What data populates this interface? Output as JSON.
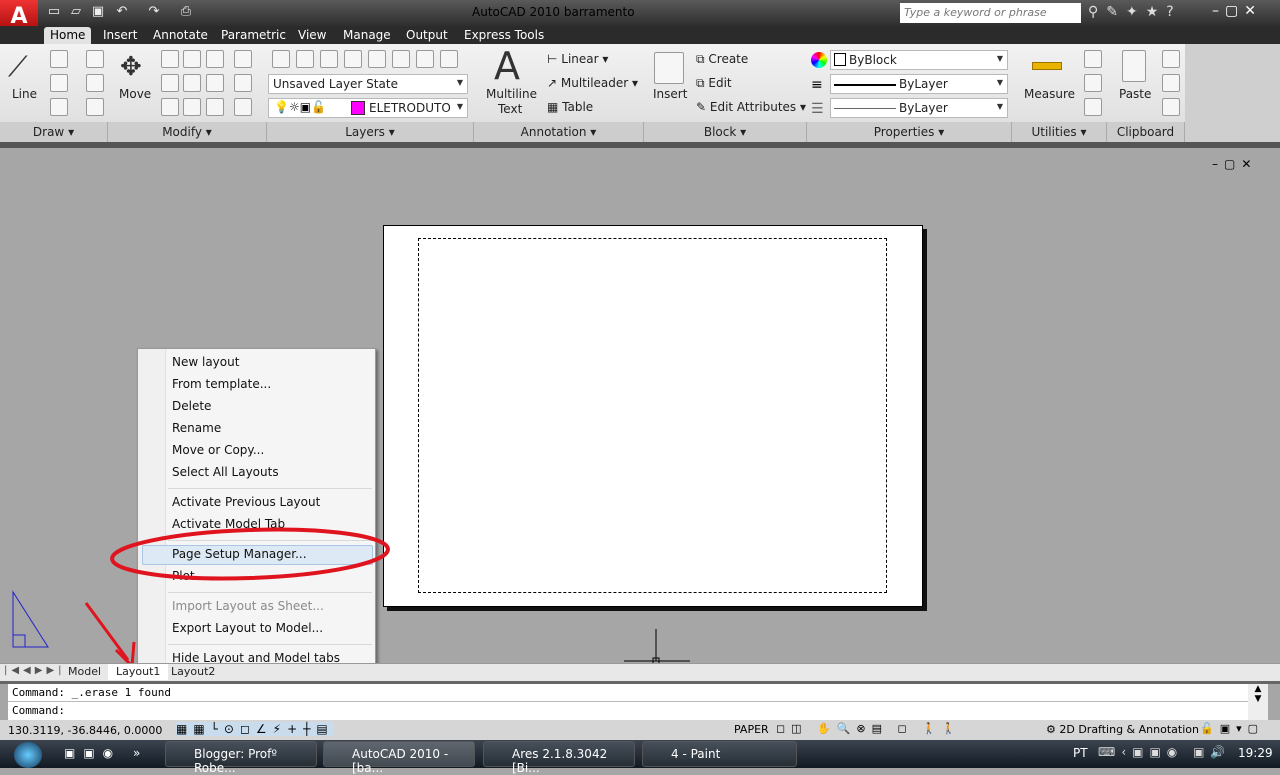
{
  "app": {
    "title": "AutoCAD 2010    barramento",
    "search_placeholder": "Type a keyword or phrase",
    "logo": "A"
  },
  "tabs": [
    "Home",
    "Insert",
    "Annotate",
    "Parametric",
    "View",
    "Manage",
    "Output",
    "Express Tools"
  ],
  "ribbon": {
    "draw": {
      "line": "Line",
      "panel": "Draw ▾"
    },
    "modify": {
      "move": "Move",
      "panel": "Modify ▾"
    },
    "layers": {
      "state": "Unsaved Layer State",
      "layer": "ELETRODUTO",
      "layer_color": "#ff00ff",
      "panel": "Layers ▾"
    },
    "annotation": {
      "mtext1": "Multiline",
      "mtext2": "Text",
      "linear": "Linear",
      "multileader": "Multileader",
      "table": "Table",
      "panel": "Annotation ▾"
    },
    "block": {
      "insert": "Insert",
      "create": "Create",
      "edit": "Edit",
      "edit_attributes": "Edit Attributes",
      "panel": "Block ▾"
    },
    "properties": {
      "color": "ByBlock",
      "lineweight": "ByLayer",
      "linetype": "ByLayer",
      "panel": "Properties ▾"
    },
    "utilities": {
      "measure": "Measure",
      "panel": "Utilities ▾"
    },
    "clipboard": {
      "paste": "Paste",
      "panel": "Clipboard"
    }
  },
  "layout_tabs": [
    "Model",
    "Layout1",
    "Layout2"
  ],
  "context_menu": [
    {
      "label": "New layout"
    },
    {
      "label": "From template..."
    },
    {
      "label": "Delete"
    },
    {
      "label": "Rename"
    },
    {
      "label": "Move or Copy..."
    },
    {
      "label": "Select All Layouts"
    },
    {
      "label": "Activate Previous Layout"
    },
    {
      "label": "Activate Model Tab"
    },
    {
      "label": "Page Setup Manager...",
      "highlighted": true
    },
    {
      "label": "Plot..."
    },
    {
      "label": "Import Layout as Sheet...",
      "disabled": true
    },
    {
      "label": "Export Layout to Model..."
    },
    {
      "label": "Hide Layout and Model tabs"
    }
  ],
  "command": {
    "line1": "Command:  _.erase 1 found",
    "line2": "Command:"
  },
  "status": {
    "coords": "130.3119, -36.8446, 0.0000",
    "paper": "PAPER",
    "workspace": "2D Drafting & Annotation"
  },
  "taskbar": {
    "items": [
      "Blogger: Profº Robe...",
      "AutoCAD 2010 - [ba...",
      "Ares 2.1.8.3042   [Bi...",
      "4 - Paint"
    ],
    "lang": "PT",
    "clock": "19:29"
  },
  "annotation_color": "#e0141e"
}
